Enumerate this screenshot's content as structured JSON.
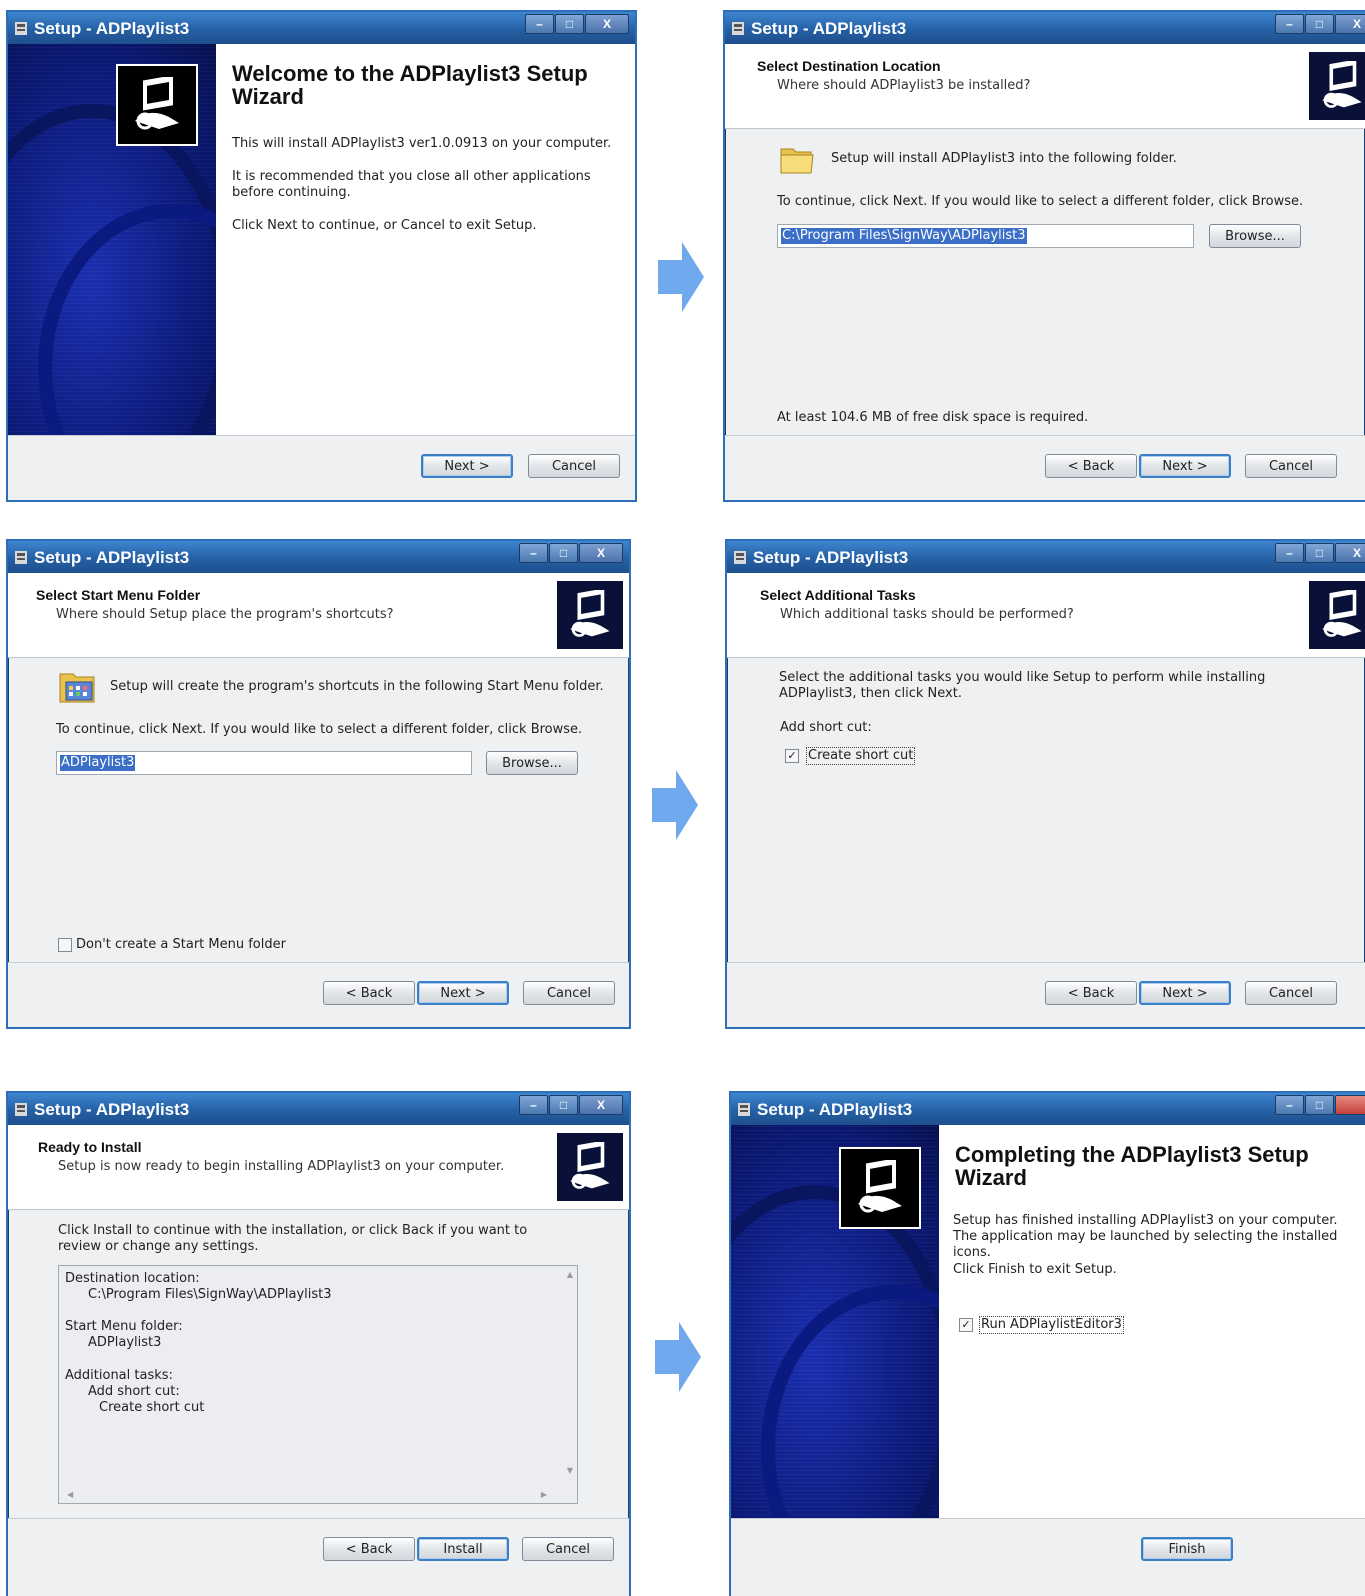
{
  "window_title": "Setup - ADPlaylist3",
  "buttons": {
    "back": "< Back",
    "next": "Next >",
    "cancel": "Cancel",
    "install": "Install",
    "finish": "Finish",
    "browse": "Browse..."
  },
  "welcome": {
    "title": "Welcome to the ADPlaylist3 Setup Wizard",
    "para1": "This will install ADPlaylist3 ver1.0.0913 on your computer.",
    "para2": "It is recommended that you close all other applications before continuing.",
    "para3": "Click Next to continue, or Cancel to exit Setup."
  },
  "destination": {
    "header_title": "Select Destination Location",
    "header_subtitle": "Where should ADPlaylist3 be installed?",
    "info": "Setup will install ADPlaylist3 into the following folder.",
    "instruction": "To continue, click Next. If you would like to select a different folder, click Browse.",
    "path": "C:\\Program Files\\SignWay\\ADPlaylist3",
    "disk_space": "At least 104.6 MB of free disk space is required."
  },
  "start_menu": {
    "header_title": "Select Start Menu Folder",
    "header_subtitle": "Where should Setup place the program's shortcuts?",
    "info": "Setup will create the program's shortcuts in the following Start Menu folder.",
    "instruction": "To continue, click Next. If you would like to select a different folder, click Browse.",
    "folder": "ADPlaylist3",
    "no_folder_checkbox": "Don't create a Start Menu folder",
    "no_folder_checked": false
  },
  "tasks": {
    "header_title": "Select Additional Tasks",
    "header_subtitle": "Which additional tasks should be performed?",
    "instruction": "Select the additional tasks you would like Setup to perform while installing ADPlaylist3, then click Next.",
    "group_label": "Add short cut:",
    "checkbox_label": "Create short cut",
    "checkbox_checked": true
  },
  "ready": {
    "header_title": "Ready to Install",
    "header_subtitle": "Setup is now ready to begin installing ADPlaylist3 on your computer.",
    "instruction": "Click Install to continue with the installation, or click Back if you want to review or change any settings.",
    "memo": {
      "dest_label": "Destination location:",
      "dest_value": "C:\\Program Files\\SignWay\\ADPlaylist3",
      "menu_label": "Start Menu folder:",
      "menu_value": "ADPlaylist3",
      "tasks_label": "Additional tasks:",
      "tasks_group": "Add short cut:",
      "tasks_item": "Create short cut"
    }
  },
  "complete": {
    "title": "Completing the ADPlaylist3 Setup Wizard",
    "para1": "Setup has finished installing ADPlaylist3 on your computer. The application may be launched by selecting the installed icons.",
    "para2": "Click Finish to exit Setup.",
    "run_checkbox": "Run ADPlaylistEditor3",
    "run_checked": true
  },
  "colors": {
    "title_bar": "#2a66ad",
    "arrow": "#6fa8ec",
    "wizard_side": "#0c1a7a",
    "selection": "#3a6ec7"
  }
}
